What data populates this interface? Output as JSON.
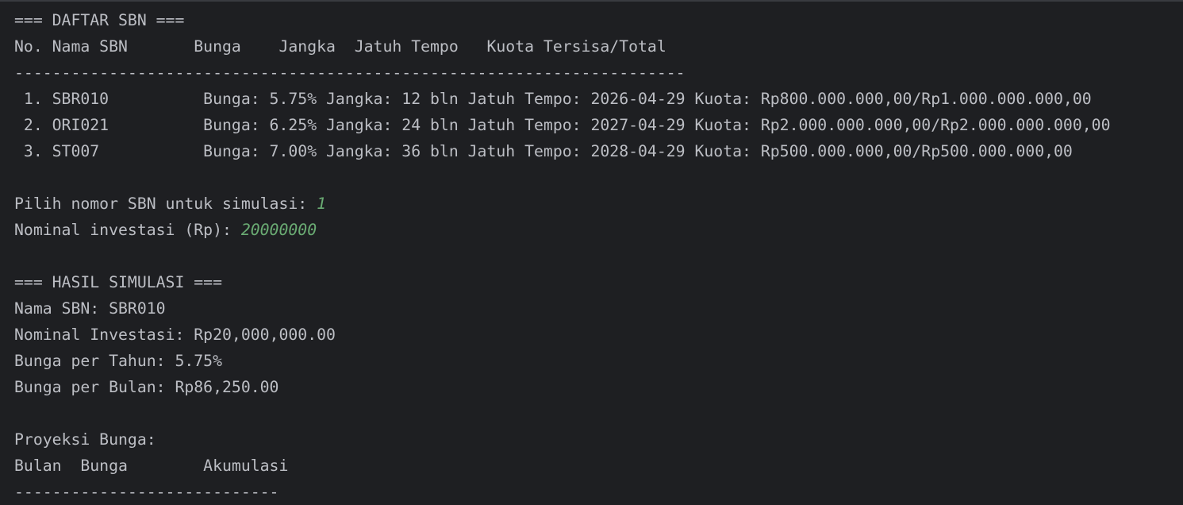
{
  "console": {
    "list_header": "=== DAFTAR SBN ===",
    "columns": "No. Nama SBN       Bunga    Jangka  Jatuh Tempo   Kuota Tersisa/Total",
    "separator_long": "-----------------------------------------------------------------------",
    "rows": [
      " 1. SBR010          Bunga: 5.75% Jangka: 12 bln Jatuh Tempo: 2026-04-29 Kuota: Rp800.000.000,00/Rp1.000.000.000,00",
      " 2. ORI021          Bunga: 6.25% Jangka: 24 bln Jatuh Tempo: 2027-04-29 Kuota: Rp2.000.000.000,00/Rp2.000.000.000,00",
      " 3. ST007           Bunga: 7.00% Jangka: 36 bln Jatuh Tempo: 2028-04-29 Kuota: Rp500.000.000,00/Rp500.000.000,00"
    ],
    "prompt_select": "Pilih nomor SBN untuk simulasi: ",
    "input_select": "1",
    "prompt_nominal": "Nominal investasi (Rp): ",
    "input_nominal": "20000000",
    "result_header": "=== HASIL SIMULASI ===",
    "result_name": "Nama SBN: SBR010",
    "result_nominal": "Nominal Investasi: Rp20,000,000.00",
    "result_rate_year": "Bunga per Tahun: 5.75%",
    "result_rate_month": "Bunga per Bulan: Rp86,250.00",
    "projection_title": "Proyeksi Bunga:",
    "projection_columns": "Bulan  Bunga        Akumulasi",
    "separator_short": "----------------------------"
  },
  "colors": {
    "background": "#1e1f22",
    "text": "#bcbec4",
    "user_input": "#6aab73"
  }
}
